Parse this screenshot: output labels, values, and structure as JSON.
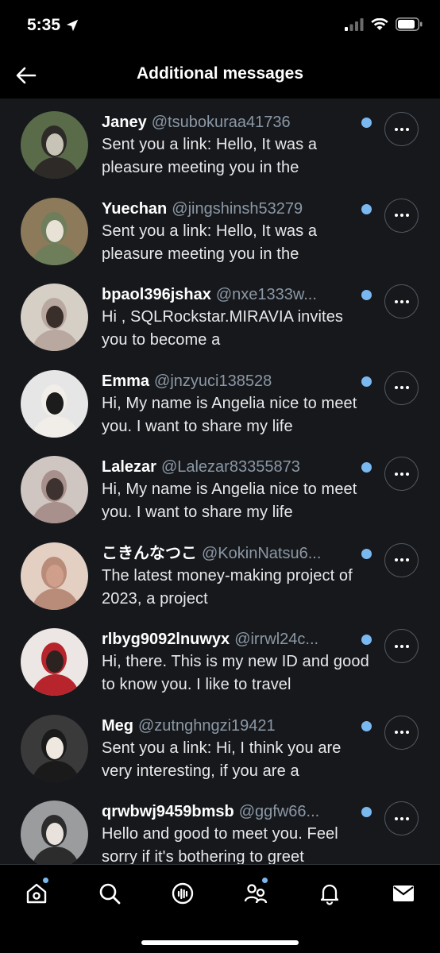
{
  "status_bar": {
    "time": "5:35"
  },
  "header": {
    "title": "Additional messages"
  },
  "messages": [
    {
      "name": "Janey",
      "handle": "@tsubokuraa41736",
      "preview": "Sent you a link: Hello, It was a pleasure meeting you in the",
      "avatar_colors": [
        "#5a6b4a",
        "#c7c3b7",
        "#2d2a27"
      ]
    },
    {
      "name": "Yuechan",
      "handle": "@jingshinsh53279",
      "preview": "Sent you a link: Hello, It was a pleasure meeting you in the",
      "avatar_colors": [
        "#8c7a5a",
        "#e8e2d6",
        "#6e7d5a"
      ]
    },
    {
      "name": "bpaol396jshax",
      "handle": "@nxe1333w...",
      "preview": "Hi , SQLRockstar.MIRAVIA invites you to become a",
      "avatar_colors": [
        "#d6cfc6",
        "#3a2e2a",
        "#b9a8a0"
      ]
    },
    {
      "name": "Emma",
      "handle": "@jnzyuci138528",
      "preview": "Hi, My name is Angelia nice to meet you.  I want to share my life",
      "avatar_colors": [
        "#e6e6e6",
        "#1c1c1c",
        "#f1ede8"
      ]
    },
    {
      "name": "Lalezar",
      "handle": "@Lalezar83355873",
      "preview": "Hi, My name is Angelia nice to meet you.  I want to share my life",
      "avatar_colors": [
        "#cfc6c2",
        "#3d3230",
        "#a8908c"
      ]
    },
    {
      "name": "こきんなつこ",
      "handle": "@KokinNatsu6...",
      "preview": "The latest money-making project of 2023, a project",
      "avatar_colors": [
        "#e4cfc3",
        "#cf9f8c",
        "#b98c7a"
      ]
    },
    {
      "name": "rlbyg9092lnuwyx",
      "handle": "@irrwl24c...",
      "preview": "Hi, there. This is my new ID and good to know you. I like to travel",
      "avatar_colors": [
        "#ece7e4",
        "#2c2220",
        "#b8242b"
      ]
    },
    {
      "name": "Meg",
      "handle": "@zutnghngzi19421",
      "preview": "Sent you a link: Hi, I think you are very interesting, if you are a",
      "avatar_colors": [
        "#3a3a3a",
        "#efe8e0",
        "#1a1a1a"
      ]
    },
    {
      "name": "qrwbwj9459bmsb",
      "handle": "@ggfw66...",
      "preview": "Hello and good to meet you. Feel sorry if it's bothering to greet",
      "avatar_colors": [
        "#9a9c9e",
        "#e9e2dc",
        "#2c2c2c"
      ]
    }
  ],
  "nav": [
    {
      "icon": "home-icon",
      "has_dot": true
    },
    {
      "icon": "search-icon",
      "has_dot": false
    },
    {
      "icon": "spaces-icon",
      "has_dot": false
    },
    {
      "icon": "communities-icon",
      "has_dot": true
    },
    {
      "icon": "notifications-icon",
      "has_dot": false
    },
    {
      "icon": "messages-icon",
      "has_dot": false
    }
  ],
  "colors": {
    "unread": "#7ab8f0",
    "background": "#000000",
    "list_bg": "#16181c"
  }
}
